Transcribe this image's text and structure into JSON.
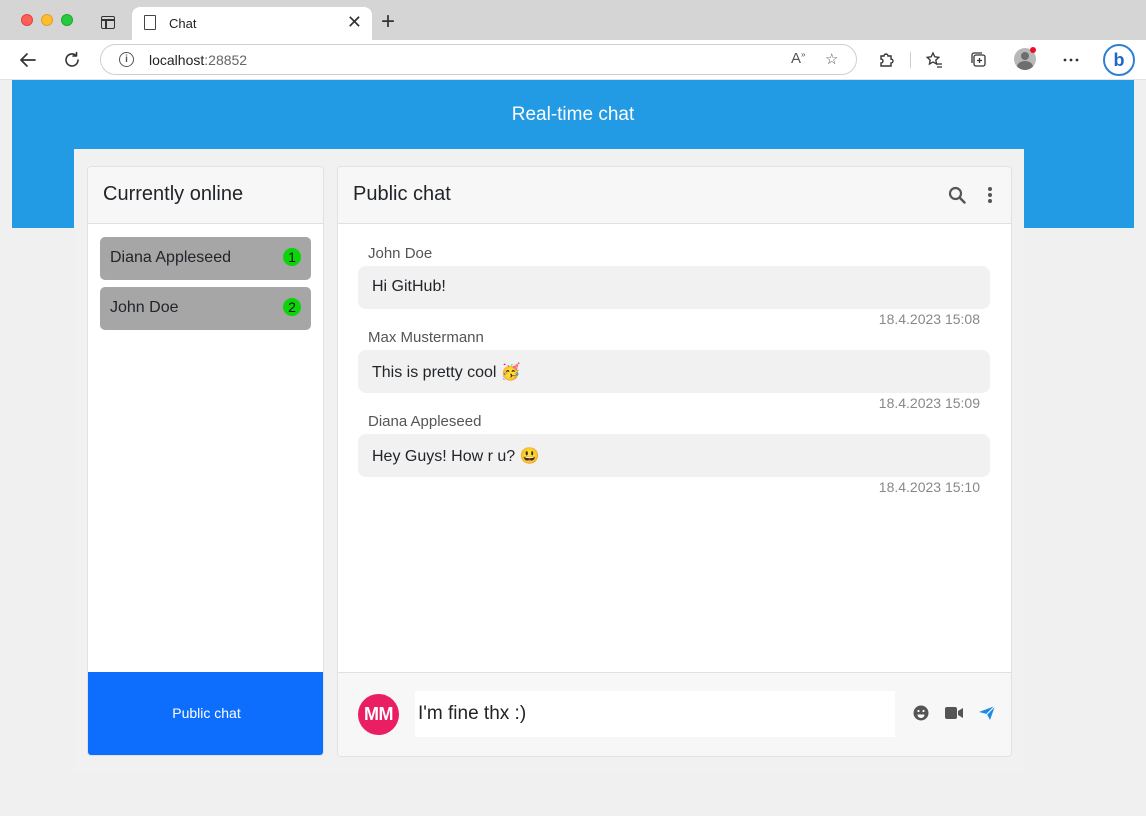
{
  "browser": {
    "tab_title": "Chat",
    "url_host": "localhost",
    "url_port": ":28852"
  },
  "page": {
    "heading": "Real-time chat"
  },
  "sidebar": {
    "title": "Currently online",
    "users": [
      {
        "name": "Diana Appleseed",
        "badge": "1"
      },
      {
        "name": "John Doe",
        "badge": "2"
      }
    ],
    "public_chat_label": "Public chat"
  },
  "chat": {
    "title": "Public chat",
    "messages": [
      {
        "author": "John Doe",
        "text": "Hi GitHub!",
        "time": "18.4.2023 15:08"
      },
      {
        "author": "Max Mustermann",
        "text": "This is pretty cool 🥳",
        "time": "18.4.2023 15:09"
      },
      {
        "author": "Diana Appleseed",
        "text": "Hey Guys! How r u? 😃",
        "time": "18.4.2023 15:10"
      }
    ]
  },
  "composer": {
    "avatar_initials": "MM",
    "input_value": "I'm fine thx :)"
  },
  "colors": {
    "hero": "#229ae4",
    "primary_button": "#0d6efd",
    "online_badge": "#0bd40b",
    "avatar": "#e91e63"
  },
  "icons": [
    "back-icon",
    "reload-icon",
    "info-icon",
    "read-aloud-icon",
    "add-favorite-icon",
    "extensions-icon",
    "favorites-icon",
    "collections-icon",
    "more-icon",
    "bing-icon",
    "search-icon",
    "kebab-icon",
    "emoji-icon",
    "video-icon",
    "send-icon"
  ]
}
